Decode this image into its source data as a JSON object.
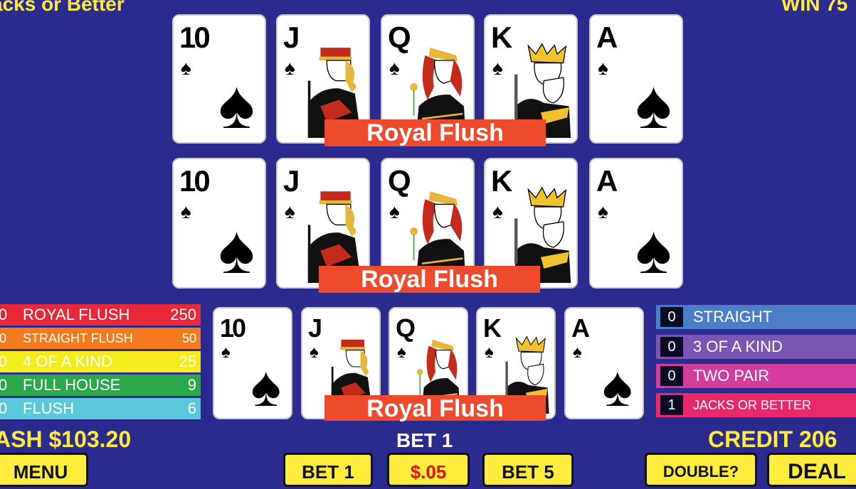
{
  "header": {
    "game_title": "acks or Better",
    "win_text": "WIN 75"
  },
  "hands": [
    {
      "label": "Royal Flush",
      "cards": [
        {
          "rank": "10",
          "suit": "spade"
        },
        {
          "rank": "J",
          "suit": "spade"
        },
        {
          "rank": "Q",
          "suit": "spade"
        },
        {
          "rank": "K",
          "suit": "spade"
        },
        {
          "rank": "A",
          "suit": "spade"
        }
      ]
    },
    {
      "label": "Royal Flush",
      "cards": [
        {
          "rank": "10",
          "suit": "spade"
        },
        {
          "rank": "J",
          "suit": "spade"
        },
        {
          "rank": "Q",
          "suit": "spade"
        },
        {
          "rank": "K",
          "suit": "spade"
        },
        {
          "rank": "A",
          "suit": "spade"
        }
      ]
    },
    {
      "label": "Royal Flush",
      "cards": [
        {
          "rank": "10",
          "suit": "spade"
        },
        {
          "rank": "J",
          "suit": "spade"
        },
        {
          "rank": "Q",
          "suit": "spade"
        },
        {
          "rank": "K",
          "suit": "spade"
        },
        {
          "rank": "A",
          "suit": "spade"
        }
      ]
    }
  ],
  "paytable_left": [
    {
      "count": "0",
      "name": "ROYAL FLUSH",
      "pay": "250",
      "color": "#e8293a"
    },
    {
      "count": "0",
      "name": "STRAIGHT FLUSH",
      "pay": "50",
      "color": "#f47b20"
    },
    {
      "count": "0",
      "name": "4 OF A KIND",
      "pay": "25",
      "color": "#f4ec1c"
    },
    {
      "count": "0",
      "name": "FULL HOUSE",
      "pay": "9",
      "color": "#2aa84a"
    },
    {
      "count": "0",
      "name": "FLUSH",
      "pay": "6",
      "color": "#5cc8dc"
    }
  ],
  "paytable_right": [
    {
      "count": "0",
      "name": "STRAIGHT",
      "color": "#4a7fc8"
    },
    {
      "count": "0",
      "name": "3 OF A KIND",
      "color": "#7a55b4"
    },
    {
      "count": "0",
      "name": "TWO PAIR",
      "color": "#d23c9c"
    },
    {
      "count": "1",
      "name": "JACKS OR BETTER",
      "color": "#e82a6c"
    }
  ],
  "status": {
    "cash": "ASH $103.20",
    "bet": "BET 1",
    "credit": "CREDIT 206"
  },
  "buttons": {
    "menu": "MENU",
    "bet1": "BET 1",
    "denom": ".05",
    "denom_prefix": "$",
    "bet5": "BET 5",
    "double": "DOUBLE?",
    "deal": "DEAL"
  },
  "colors": {
    "background": "#2b2a8f",
    "accent_yellow": "#ffec3d",
    "hand_label_bg": "#ee4b2e",
    "denom_text": "#e01010"
  }
}
